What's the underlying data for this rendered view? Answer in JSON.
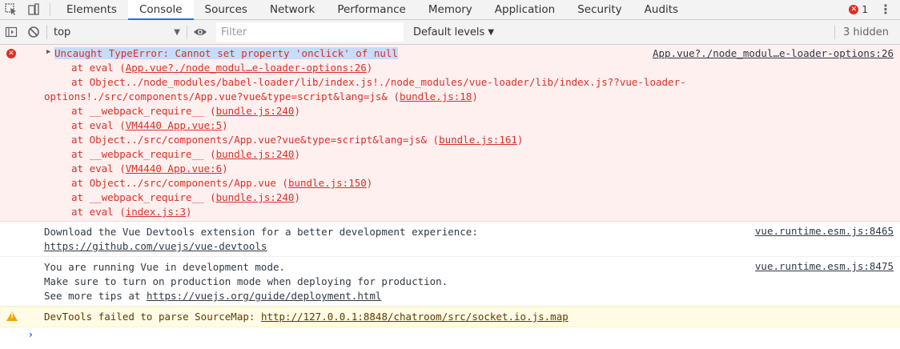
{
  "tabs": [
    "Elements",
    "Console",
    "Sources",
    "Network",
    "Performance",
    "Memory",
    "Application",
    "Security",
    "Audits"
  ],
  "active_tab": "Console",
  "error_count": "1",
  "toolbar": {
    "context": "top",
    "filter_placeholder": "Filter",
    "levels": "Default levels",
    "hidden": "3 hidden"
  },
  "error": {
    "message": "Uncaught TypeError: Cannot set property 'onclick' of null",
    "source": "App.vue?./node_modul…e-loader-options:26",
    "stack": [
      {
        "pre": "at eval (",
        "link": "App.vue?./node_modul…e-loader-options:26",
        "post": ")"
      },
      {
        "pre": "at Object../node_modules/babel-loader/lib/index.js!./node_modules/vue-loader/lib/index.js??vue-loader-",
        "link": "",
        "post": ""
      },
      {
        "pre": "options!./src/components/App.vue?vue&type=script&lang=js& (",
        "link": "bundle.js:18",
        "post": ")",
        "wrap": true
      },
      {
        "pre": "at __webpack_require__ (",
        "link": "bundle.js:240",
        "post": ")"
      },
      {
        "pre": "at eval (",
        "link": "VM4440 App.vue:5",
        "post": ")"
      },
      {
        "pre": "at Object../src/components/App.vue?vue&type=script&lang=js& (",
        "link": "bundle.js:161",
        "post": ")"
      },
      {
        "pre": "at __webpack_require__ (",
        "link": "bundle.js:240",
        "post": ")"
      },
      {
        "pre": "at eval (",
        "link": "VM4440 App.vue:6",
        "post": ")"
      },
      {
        "pre": "at Object../src/components/App.vue (",
        "link": "bundle.js:150",
        "post": ")"
      },
      {
        "pre": "at __webpack_require__ (",
        "link": "bundle.js:240",
        "post": ")"
      },
      {
        "pre": "at eval (",
        "link": "index.js:3",
        "post": ")"
      }
    ]
  },
  "devtools_msg": {
    "line1": "Download the Vue Devtools extension for a better development experience:",
    "link": "https://github.com/vuejs/vue-devtools",
    "source": "vue.runtime.esm.js:8465"
  },
  "devmode_msg": {
    "line1": "You are running Vue in development mode.",
    "line2": "Make sure to turn on production mode when deploying for production.",
    "line3_pre": "See more tips at ",
    "link": "https://vuejs.org/guide/deployment.html",
    "source": "vue.runtime.esm.js:8475"
  },
  "warning": {
    "pre": "DevTools failed to parse SourceMap: ",
    "link": "http://127.0.0.1:8848/chatroom/src/socket.io.js.map"
  },
  "colors": {
    "error_text": "#d93025",
    "error_bg": "#fff0f0",
    "warn_bg": "#fffbe5",
    "accent": "#1a73e8"
  }
}
